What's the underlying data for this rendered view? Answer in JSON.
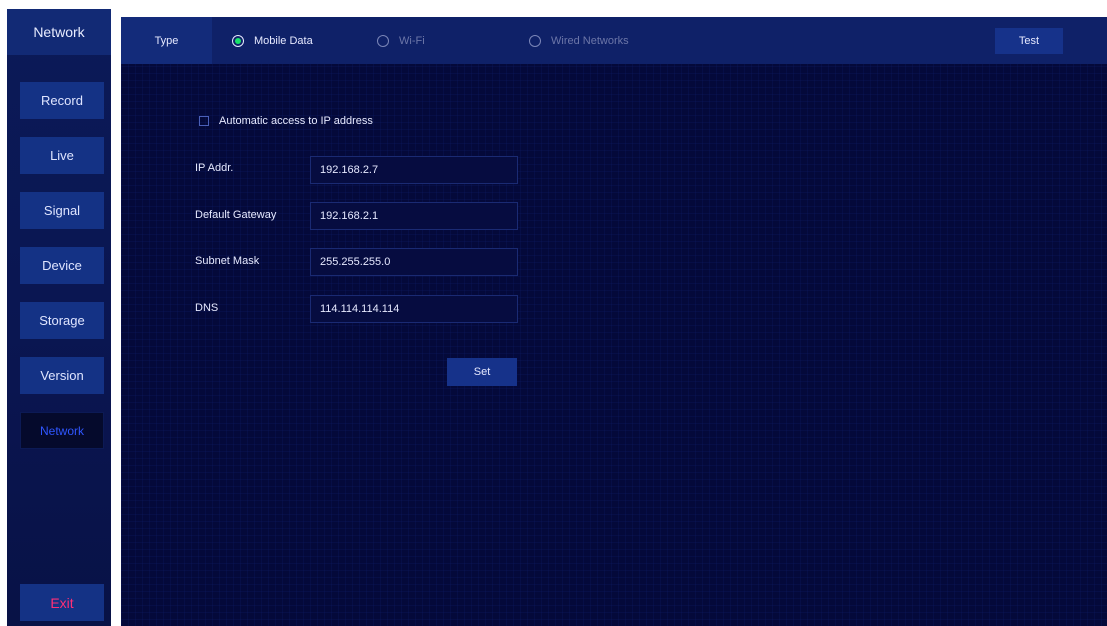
{
  "sidebar": {
    "title": "Network",
    "items": [
      {
        "label": "Record"
      },
      {
        "label": "Live"
      },
      {
        "label": "Signal"
      },
      {
        "label": "Device"
      },
      {
        "label": "Storage"
      },
      {
        "label": "Version"
      },
      {
        "label": "Network",
        "active": true
      }
    ],
    "exit_label": "Exit"
  },
  "topbar": {
    "type_label": "Type",
    "options": [
      {
        "label": "Mobile Data",
        "selected": true
      },
      {
        "label": "Wi-Fi",
        "selected": false
      },
      {
        "label": "Wired Networks",
        "selected": false
      }
    ],
    "test_label": "Test"
  },
  "form": {
    "auto_ip_label": "Automatic access to IP address",
    "auto_ip_checked": false,
    "fields": [
      {
        "label": "IP Addr.",
        "value": "192.168.2.7"
      },
      {
        "label": "Default Gateway",
        "value": "192.168.2.1"
      },
      {
        "label": "Subnet Mask",
        "value": "255.255.255.0"
      },
      {
        "label": "DNS",
        "value": "114.114.114.114"
      }
    ],
    "set_label": "Set"
  },
  "colors": {
    "selected_radio": "#18e46a",
    "active_nav_text": "#2f56ff",
    "exit_text": "#ff2f77",
    "panel_bg": "#04093a"
  }
}
